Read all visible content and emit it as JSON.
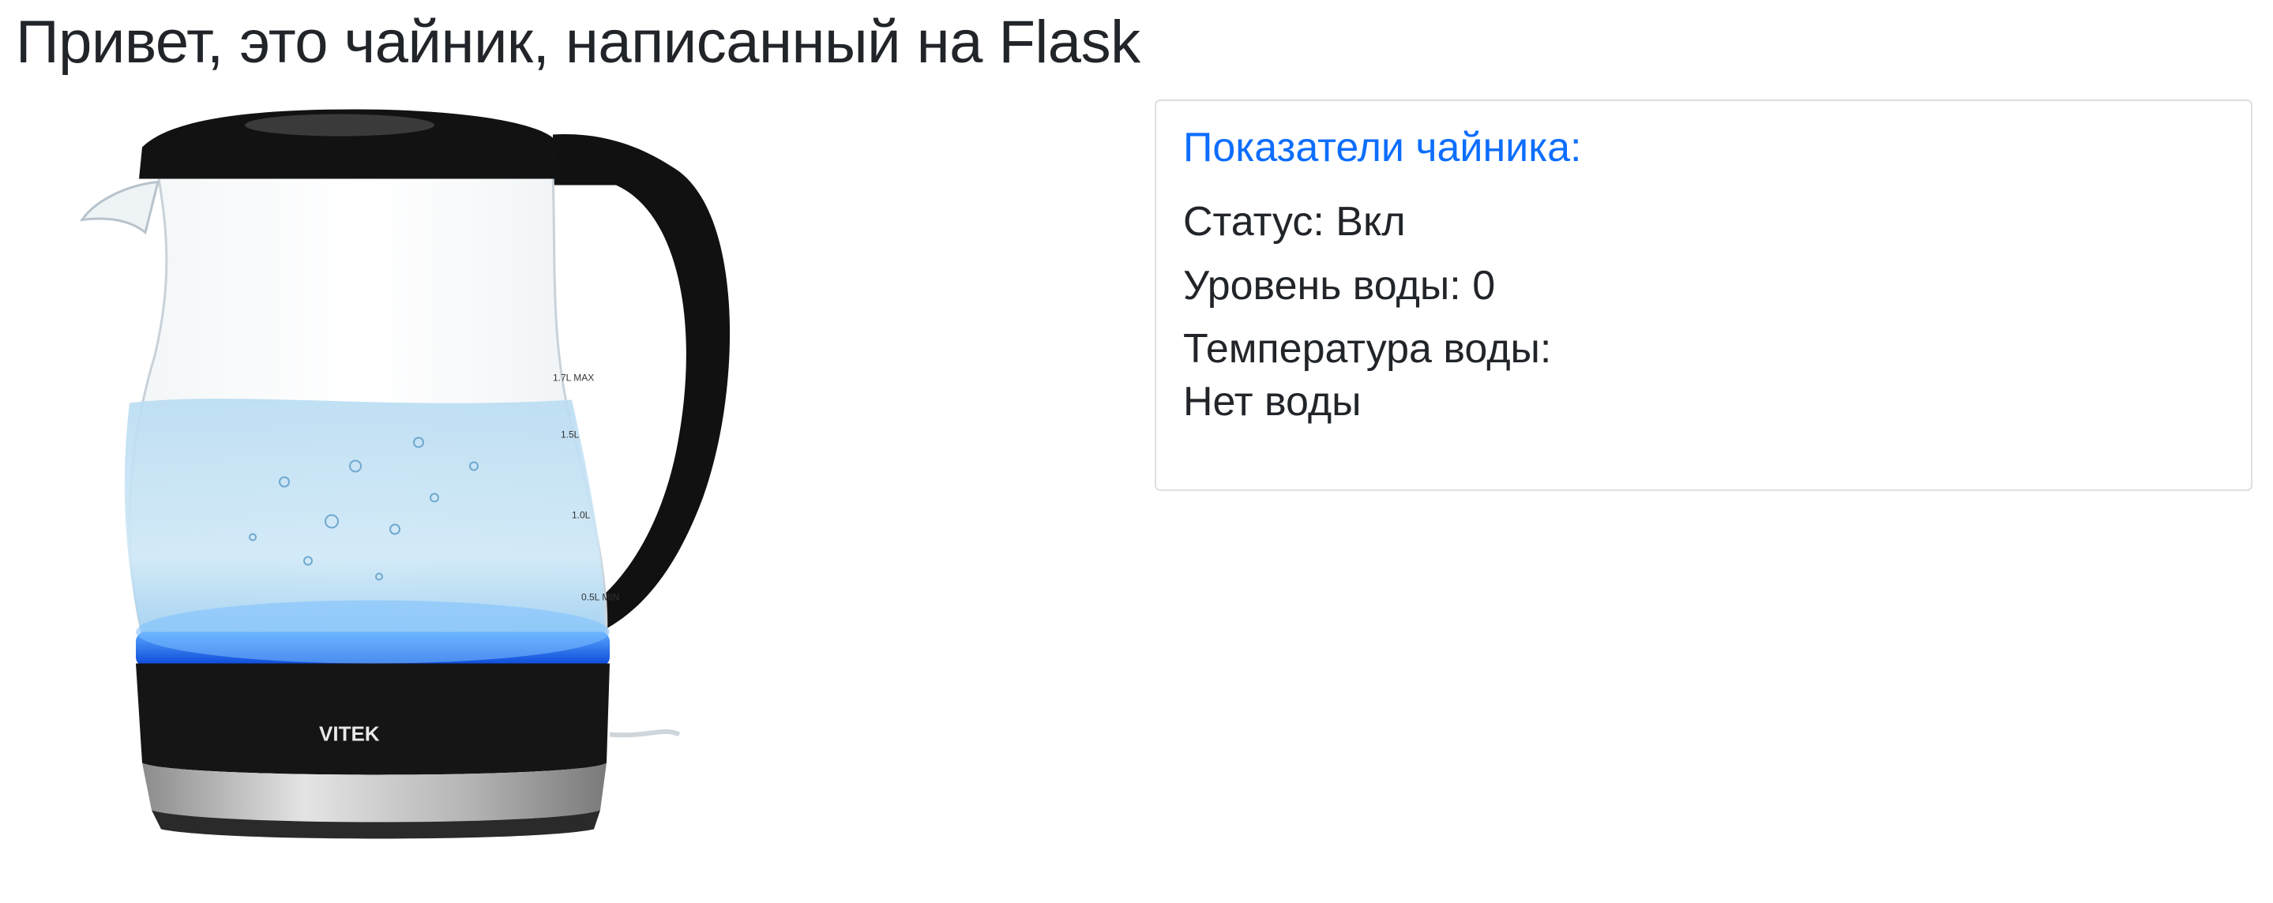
{
  "page": {
    "title": "Привет, это чайник, написанный на Flask"
  },
  "kettle_image": {
    "brand": "VITEK",
    "scale_marks": [
      "1.7L MAX",
      "1.5L",
      "1.0L",
      "0.5L MIN"
    ]
  },
  "stats_card": {
    "title": "Показатели чайника:",
    "status": {
      "label": "Статус:",
      "value": "Вкл"
    },
    "water_level": {
      "label": "Уровень воды:",
      "value": "0"
    },
    "water_temperature": {
      "label": "Температура воды:",
      "value": "Нет воды"
    }
  },
  "colors": {
    "title_accent": "#0d6efd",
    "text": "#212529",
    "card_border": "#dfdfdf",
    "kettle_led": "#1e6bff"
  }
}
